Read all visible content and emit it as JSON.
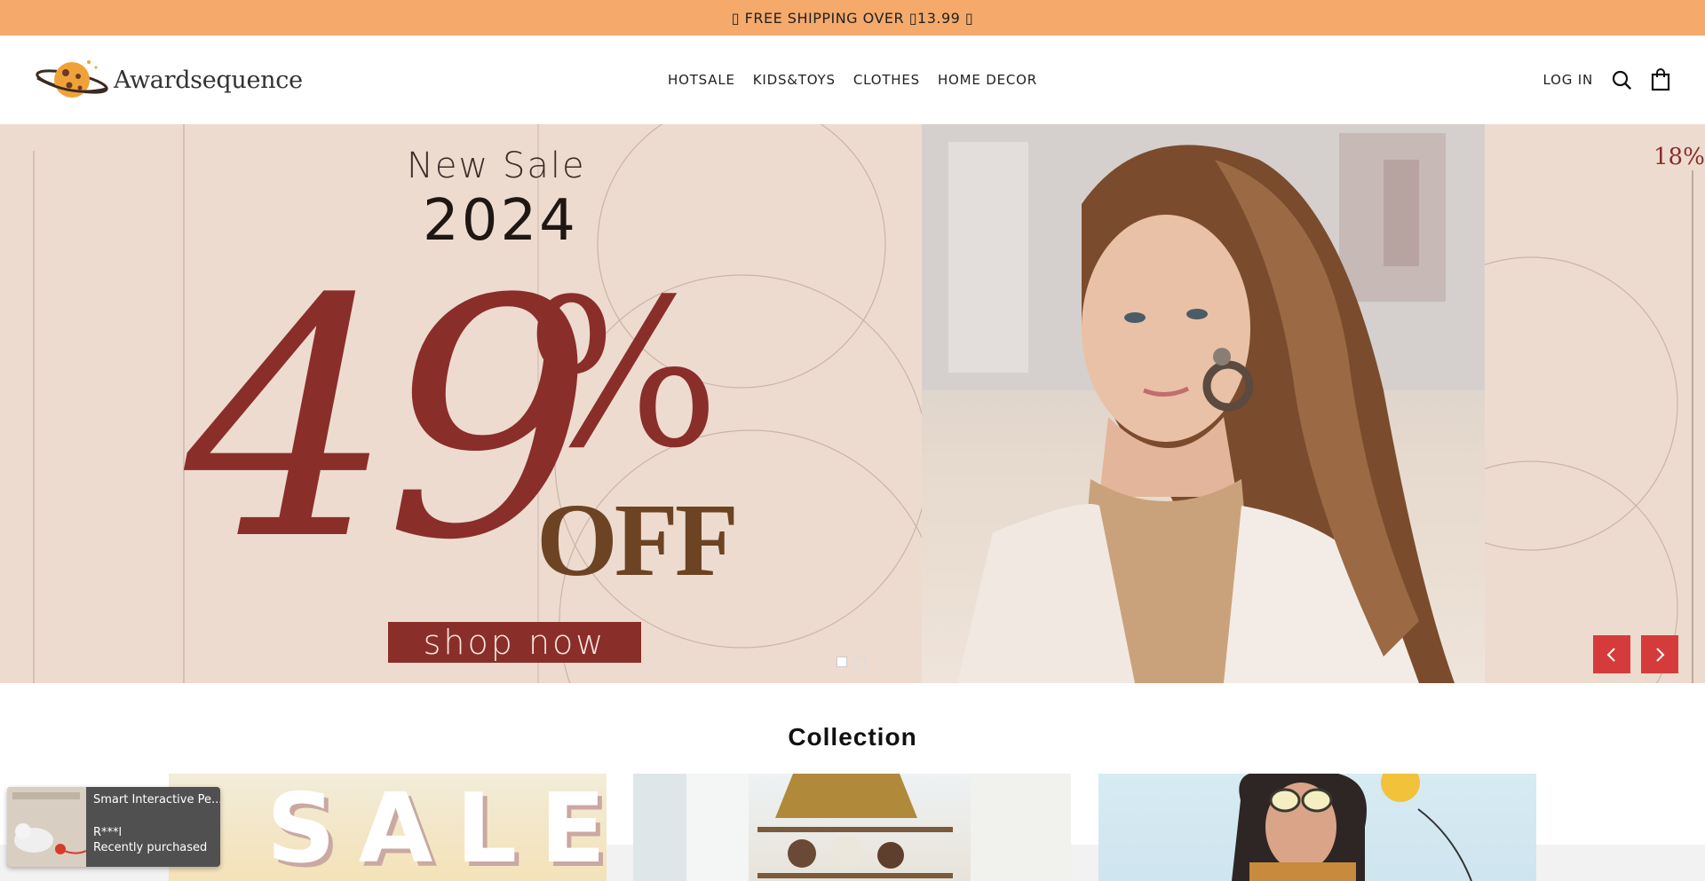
{
  "announcement": {
    "text": "▯ FREE SHIPPING OVER ▯13.99 ▯"
  },
  "header": {
    "logo_text": "Awardsequence",
    "nav": [
      {
        "label": "HOTSALE"
      },
      {
        "label": "KIDS&TOYS"
      },
      {
        "label": "CLOTHES"
      },
      {
        "label": "HOME DECOR"
      }
    ],
    "login_label": "LOG IN",
    "icons": [
      "search-icon",
      "cart-icon"
    ]
  },
  "hero": {
    "headline": "New Sale",
    "year": "2024",
    "discount_number": "49",
    "discount_percent": "%",
    "discount_word": "OFF",
    "cta_label": "shop now",
    "next_slide_percent": "18%",
    "slide_count": 2,
    "active_slide": 1,
    "colors": {
      "background": "#eedbcf",
      "accent": "#8a2e2a",
      "off": "#6c4424",
      "arrows": "#d63b3b"
    }
  },
  "collection": {
    "title": "Collection",
    "card_1_text": "SALE"
  },
  "purchase_popup": {
    "product": "Smart Interactive Pe...",
    "buyer": "R***l",
    "status": "Recently purchased"
  }
}
